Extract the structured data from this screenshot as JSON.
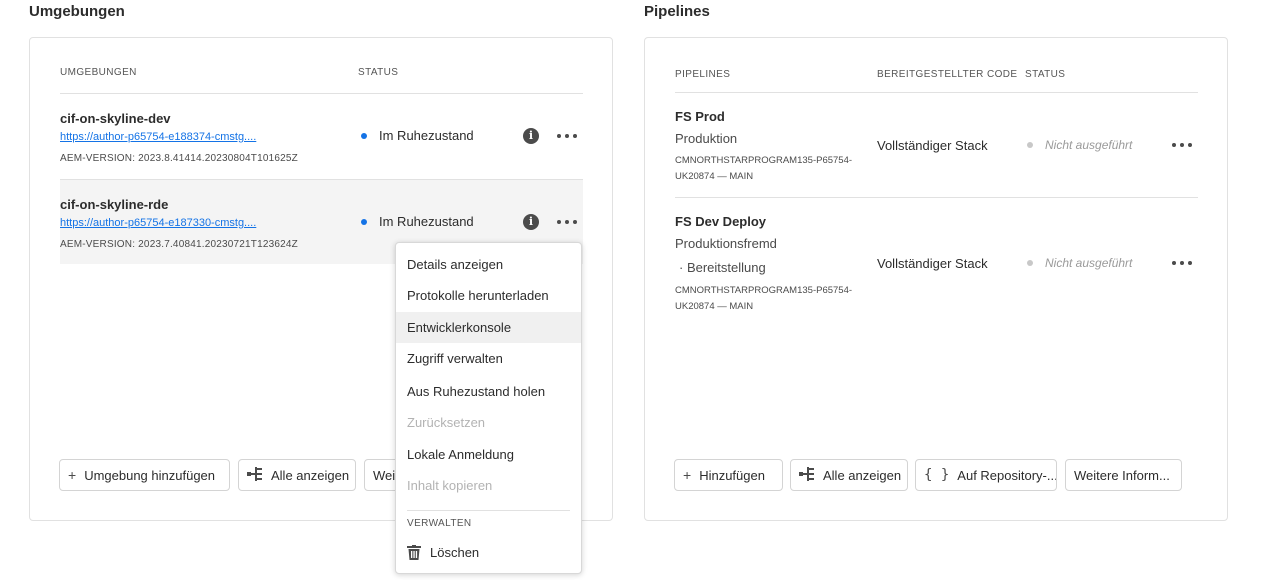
{
  "environments": {
    "title": "Umgebungen",
    "columns": {
      "name": "UMGEBUNGEN",
      "status": "STATUS"
    },
    "rows": [
      {
        "name": "cif-on-skyline-dev",
        "link": "https://author-p65754-e188374-cmstg....",
        "version": "AEM-VERSION: 2023.8.41414.20230804T101625Z",
        "status": "Im Ruhezustand"
      },
      {
        "name": "cif-on-skyline-rde",
        "link": "https://author-p65754-e187330-cmstg....",
        "version": "AEM-VERSION: 2023.7.40841.20230721T123624Z",
        "status": "Im Ruhezustand"
      }
    ],
    "buttons": {
      "add": "Umgebung hinzufügen",
      "show_all": "Alle anzeigen",
      "more": "Wei"
    },
    "status_color": "#1473e6"
  },
  "pipelines": {
    "title": "Pipelines",
    "columns": {
      "name": "PIPELINES",
      "code": "BEREITGESTELLTER CODE",
      "status": "STATUS"
    },
    "rows": [
      {
        "name": "FS Prod",
        "type": "Produktion",
        "subtype": "",
        "code": "CMNORTHSTARPROGRAM135-P65754-UK20874 — MAIN",
        "deployed": "Vollständiger Stack",
        "status": "Nicht ausgeführt"
      },
      {
        "name": "FS Dev Deploy",
        "type": "Produktionsfremd",
        "subtype": "· Bereitstellung",
        "code": "CMNORTHSTARPROGRAM135-P65754-UK20874 — MAIN",
        "deployed": "Vollständiger Stack",
        "status": "Nicht ausgeführt"
      }
    ],
    "buttons": {
      "add": "Hinzufügen",
      "show_all": "Alle anzeigen",
      "repo": "Auf Repository-...",
      "more": "Weitere Inform..."
    }
  },
  "context_menu": {
    "items": [
      {
        "label": "Details anzeigen",
        "disabled": false
      },
      {
        "label": "Protokolle herunterladen",
        "disabled": false
      },
      {
        "label": "Entwicklerkonsole",
        "disabled": false,
        "highlighted": true
      },
      {
        "label": "Zugriff verwalten",
        "disabled": false
      },
      {
        "label": "Aus Ruhezustand holen",
        "disabled": false
      },
      {
        "label": "Zurücksetzen",
        "disabled": true
      },
      {
        "label": "Lokale Anmeldung",
        "disabled": false
      },
      {
        "label": "Inhalt kopieren",
        "disabled": true
      }
    ],
    "section_header": "VERWALTEN",
    "delete_label": "Löschen"
  },
  "icons": {
    "info": "info-icon",
    "more": "more-icon",
    "add": "plus-icon",
    "show_all": "tree-view-icon",
    "repo": "code-braces-icon",
    "delete": "trash-icon"
  }
}
